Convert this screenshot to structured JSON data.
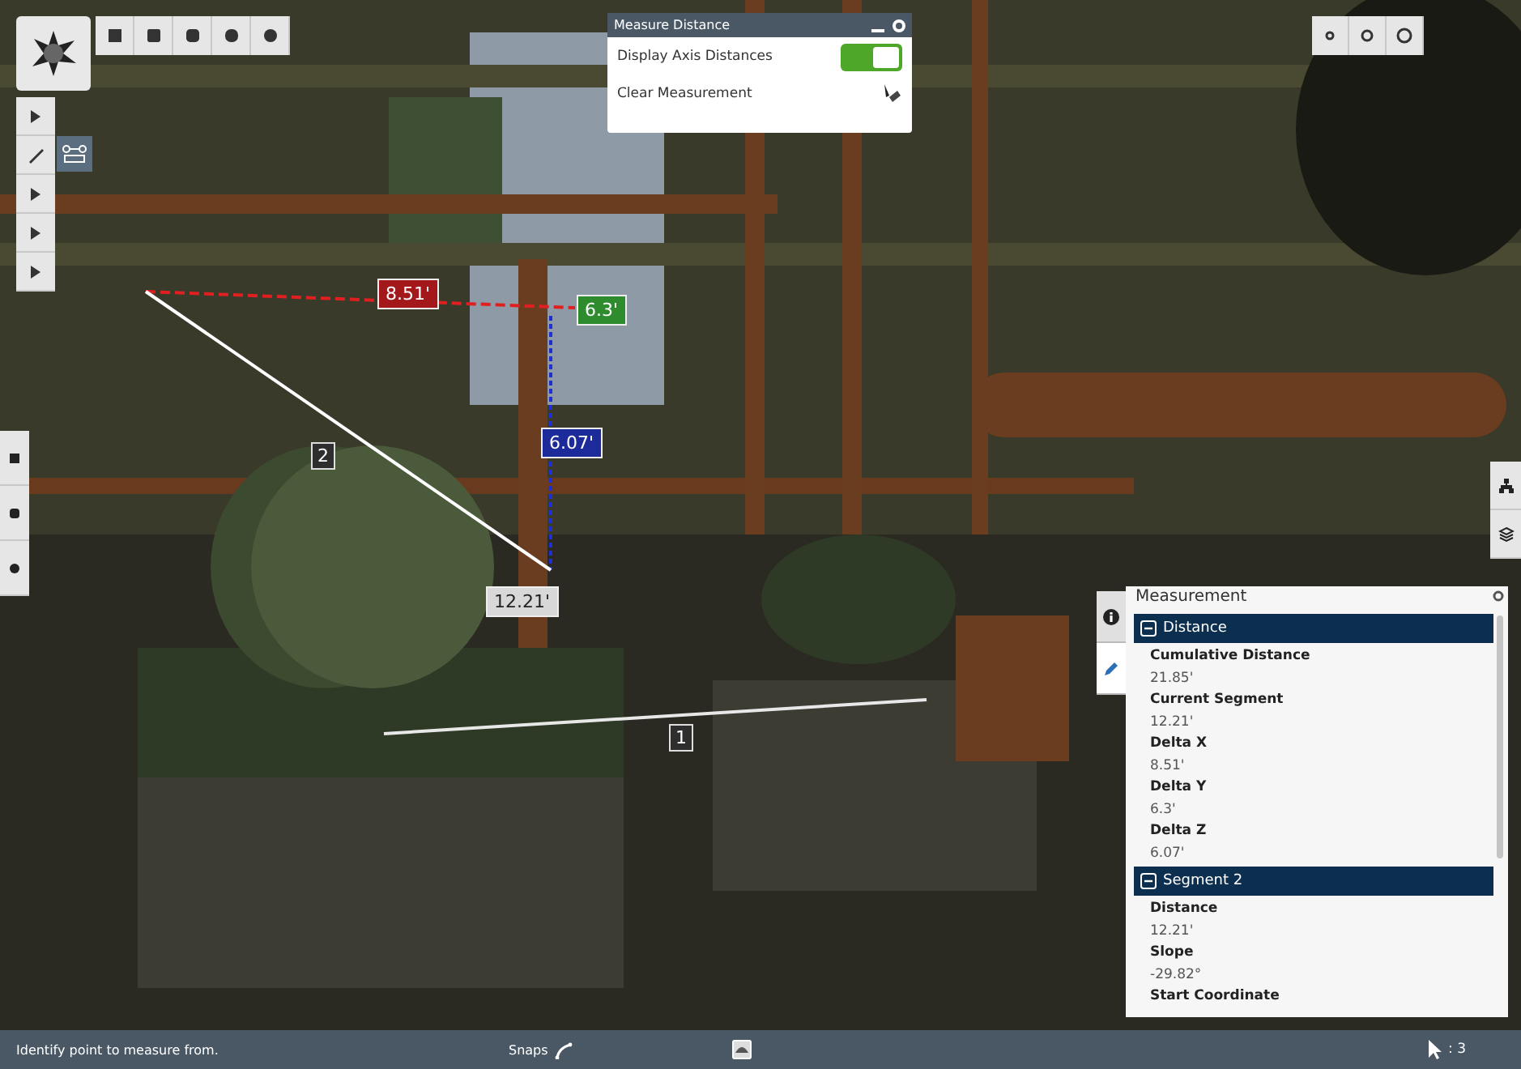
{
  "measure_dialog": {
    "title": "Measure Distance",
    "options": [
      {
        "kind": "toggle",
        "label": "Display Axis Distances",
        "on": true
      },
      {
        "kind": "action",
        "label": "Clear Measurement"
      }
    ]
  },
  "measure_labels": [
    {
      "text": "8.51'",
      "color": "#a3191b"
    },
    {
      "text": "6.3'",
      "color": "#2e8b2e"
    },
    {
      "text": "6.07'",
      "color": "#1c2a9a"
    },
    {
      "text": "12.21'",
      "color": "#d8d8d8"
    },
    {
      "text": "2",
      "color": "#2e2e2e"
    },
    {
      "text": "1",
      "color": "#2e2e2e"
    }
  ],
  "panel_tabs": [
    {
      "selected": false
    },
    {
      "selected": true
    }
  ],
  "measurement_panel": {
    "title": "Measurement",
    "sections": [
      {
        "title": "Distance",
        "expanded": true,
        "fields": [
          {
            "label": "Cumulative Distance",
            "value": "21.85'"
          },
          {
            "label": "Current Segment",
            "value": "12.21'"
          },
          {
            "label": "Delta X",
            "value": "8.51'"
          },
          {
            "label": "Delta Y",
            "value": "6.3'"
          },
          {
            "label": "Delta Z",
            "value": "6.07'"
          }
        ]
      },
      {
        "title": "Segment 2",
        "expanded": true,
        "fields": [
          {
            "label": "Distance",
            "value": "12.21'"
          },
          {
            "label": "Slope",
            "value": "-29.82°"
          },
          {
            "label": "Start Coordinate"
          }
        ]
      }
    ]
  },
  "status_bar": {
    "message": "Identify point to measure from.",
    "snaps_label": "Snaps",
    "selection_count": ": 3"
  }
}
